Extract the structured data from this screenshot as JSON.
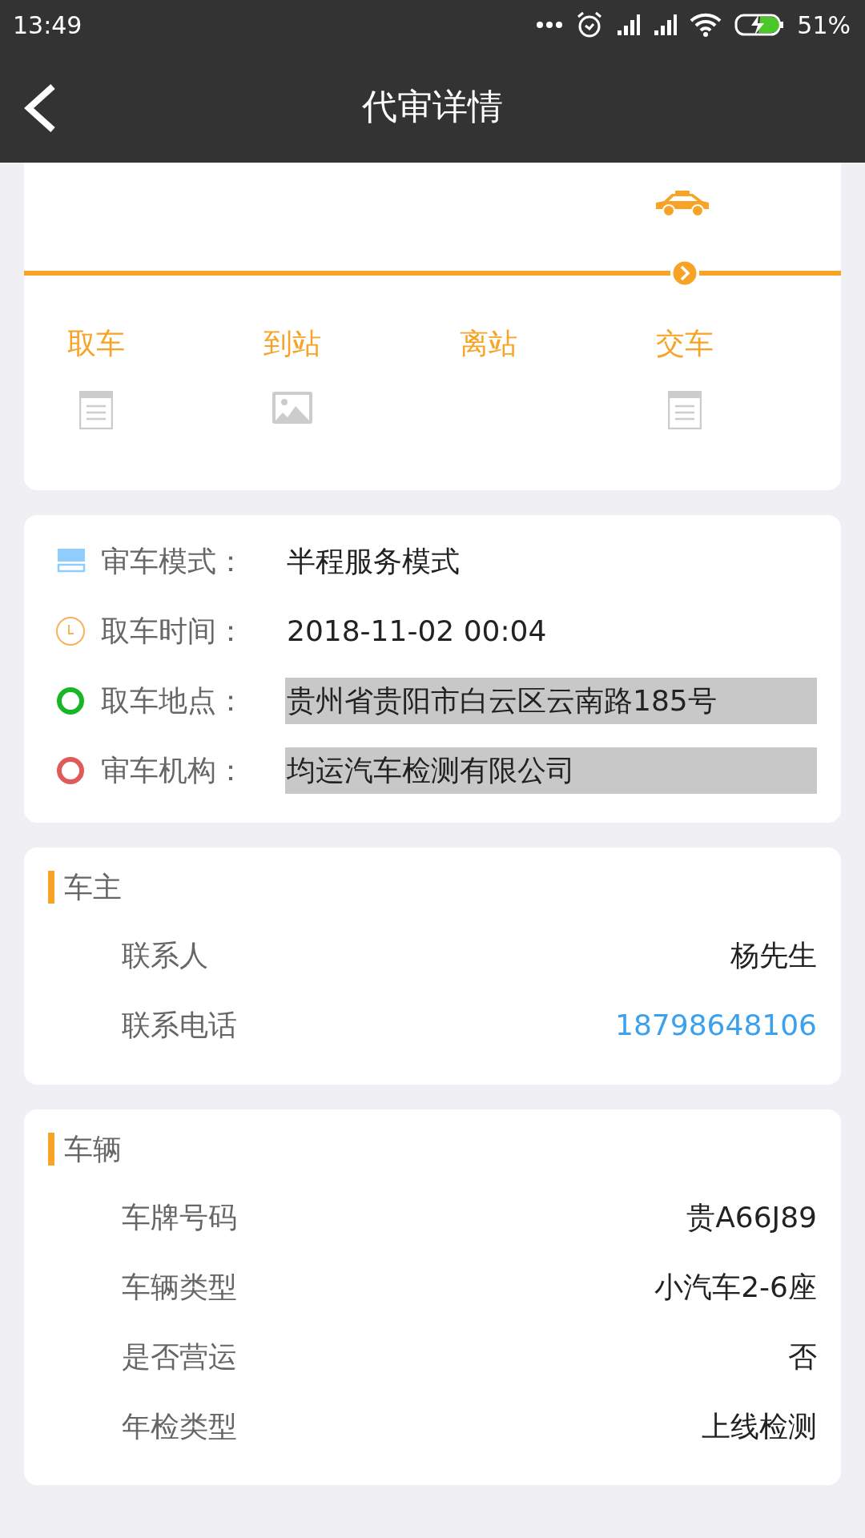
{
  "status_bar": {
    "time": "13:49",
    "battery": "51%"
  },
  "header": {
    "title": "代审详情"
  },
  "progress": {
    "steps": [
      {
        "label": "取车",
        "current": false,
        "kind": "document"
      },
      {
        "label": "到站",
        "current": false,
        "kind": "image"
      },
      {
        "label": "离站",
        "current": false,
        "kind": "none"
      },
      {
        "label": "交车",
        "current": true,
        "kind": "document"
      }
    ]
  },
  "order_info": [
    {
      "kind": "mode",
      "label": "审车模式：",
      "value": "半程服务模式",
      "highlighted": false
    },
    {
      "kind": "clock",
      "label": "取车时间：",
      "value": "2018-11-02 00:04",
      "highlighted": false
    },
    {
      "kind": "start",
      "label": "取车地点：",
      "value": "贵州省贵阳市白云区云南路185号",
      "highlighted": true
    },
    {
      "kind": "end",
      "label": "审车机构：",
      "value": "均运汽车检测有限公司",
      "highlighted": true
    }
  ],
  "sections": [
    {
      "title": "车主",
      "rows": [
        {
          "label": "联系人",
          "value": "杨先生",
          "link": false
        },
        {
          "label": "联系电话",
          "value": "18798648106",
          "link": true
        }
      ]
    },
    {
      "title": "车辆",
      "rows": [
        {
          "label": "车牌号码",
          "value": "贵A66J89",
          "link": false
        },
        {
          "label": "车辆类型",
          "value": "小汽车2-6座",
          "link": false
        },
        {
          "label": "是否营运",
          "value": "否",
          "link": false
        },
        {
          "label": "年检类型",
          "value": "上线检测",
          "link": false
        }
      ]
    }
  ]
}
